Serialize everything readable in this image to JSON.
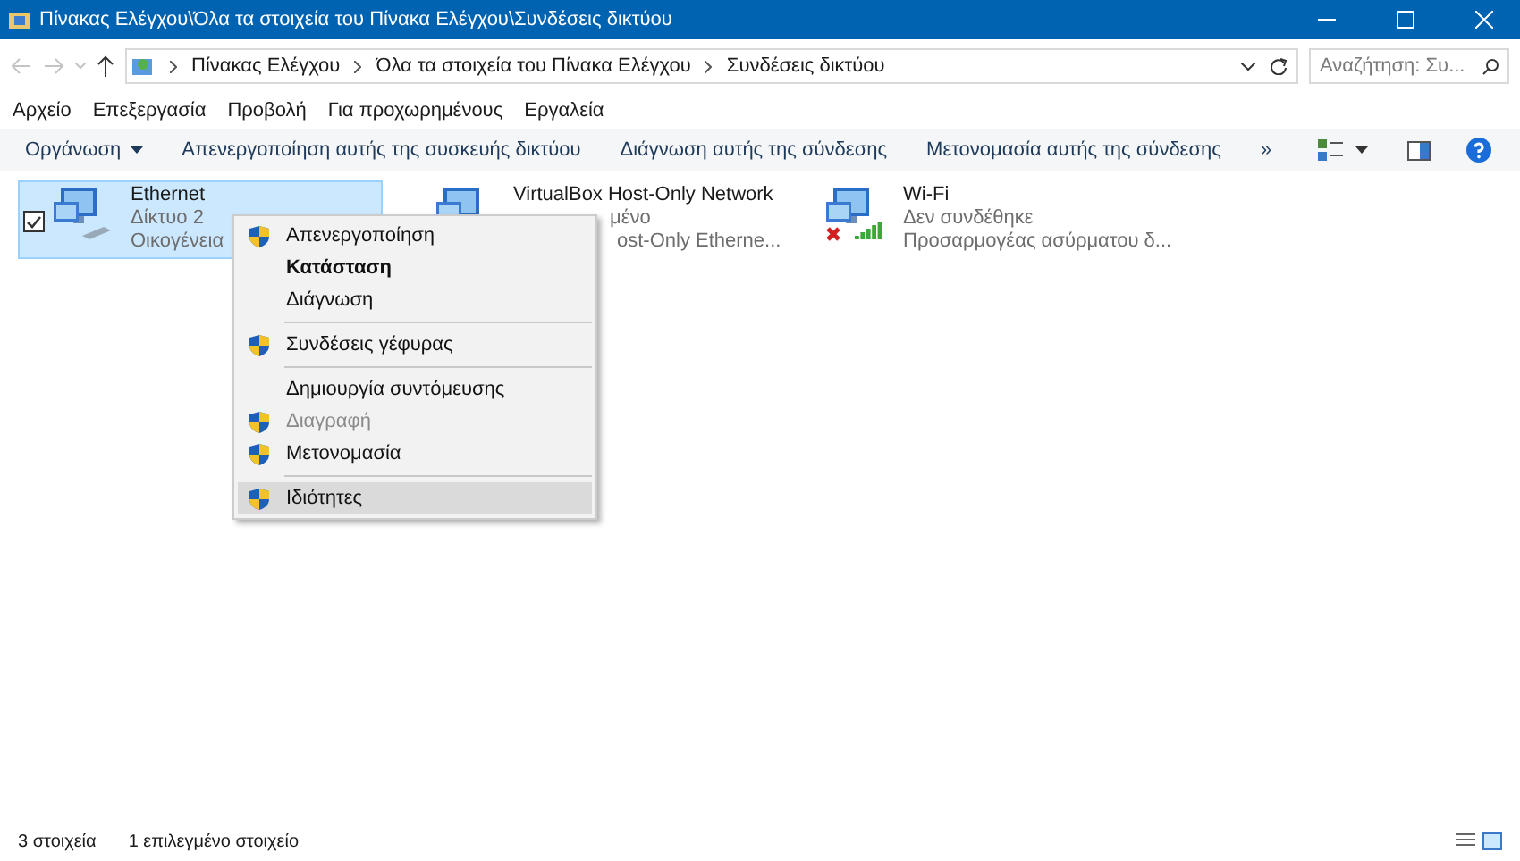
{
  "window": {
    "title": "Πίνακας Ελέγχου\\Όλα τα στοιχεία του Πίνακα Ελέγχου\\Συνδέσεις δικτύου"
  },
  "address": {
    "crumbs": [
      "Πίνακας Ελέγχου",
      "Όλα τα στοιχεία του Πίνακα Ελέγχου",
      "Συνδέσεις δικτύου"
    ],
    "search_placeholder": "Αναζήτηση: Συ..."
  },
  "menu_bar": [
    "Αρχείο",
    "Επεξεργασία",
    "Προβολή",
    "Για προχωρημένους",
    "Εργαλεία"
  ],
  "toolbar": [
    {
      "label": "Οργάνωση",
      "kind": "dropdown"
    },
    {
      "label": "Απενεργοποίηση αυτής της συσκευής δικτύου",
      "kind": "plain"
    },
    {
      "label": "Διάγνωση αυτής της σύνδεσης",
      "kind": "plain"
    },
    {
      "label": "Μετονομασία αυτής της σύνδεσης",
      "kind": "plain"
    },
    {
      "label": "»",
      "kind": "plain"
    }
  ],
  "connections": [
    {
      "name": "Ethernet",
      "line_2": "Δίκτυο 2",
      "line_3": "Οικογένεια",
      "selected": true,
      "checked": true,
      "kind": "wired",
      "partly_covered": false
    },
    {
      "name": "VirtualBox Host-Only Network",
      "line_2": "μένο",
      "line_3": "ost-Only Etherne...",
      "selected": false,
      "checked": false,
      "kind": "wired",
      "partly_covered": true
    },
    {
      "name": "Wi-Fi",
      "line_2": "Δεν συνδέθηκε",
      "line_3": "Προσαρμογέας ασύρματου δ...",
      "selected": false,
      "checked": false,
      "kind": "wireless",
      "partly_covered": false
    }
  ],
  "context_menu": [
    {
      "kind": "item",
      "label": "Απενεργοποίηση",
      "shield": true,
      "bold": false,
      "disabled": false,
      "selected": false
    },
    {
      "kind": "item",
      "label": "Κατάσταση",
      "shield": false,
      "bold": true,
      "disabled": false,
      "selected": false
    },
    {
      "kind": "item",
      "label": "Διάγνωση",
      "shield": false,
      "bold": false,
      "disabled": false,
      "selected": false
    },
    {
      "kind": "separator"
    },
    {
      "kind": "item",
      "label": "Συνδέσεις γέφυρας",
      "shield": true,
      "bold": false,
      "disabled": false,
      "selected": false
    },
    {
      "kind": "separator"
    },
    {
      "kind": "item",
      "label": "Δημιουργία συντόμευσης",
      "shield": false,
      "bold": false,
      "disabled": false,
      "selected": false
    },
    {
      "kind": "item",
      "label": "Διαγραφή",
      "shield": true,
      "bold": false,
      "disabled": true,
      "selected": false
    },
    {
      "kind": "item",
      "label": "Μετονομασία",
      "shield": true,
      "bold": false,
      "disabled": false,
      "selected": false
    },
    {
      "kind": "separator"
    },
    {
      "kind": "item",
      "label": "Ιδιότητες",
      "shield": true,
      "bold": false,
      "disabled": false,
      "selected": true
    }
  ],
  "status_bar": {
    "count": "3 στοιχεία",
    "selection": "1 επιλεγμένο στοιχείο"
  }
}
